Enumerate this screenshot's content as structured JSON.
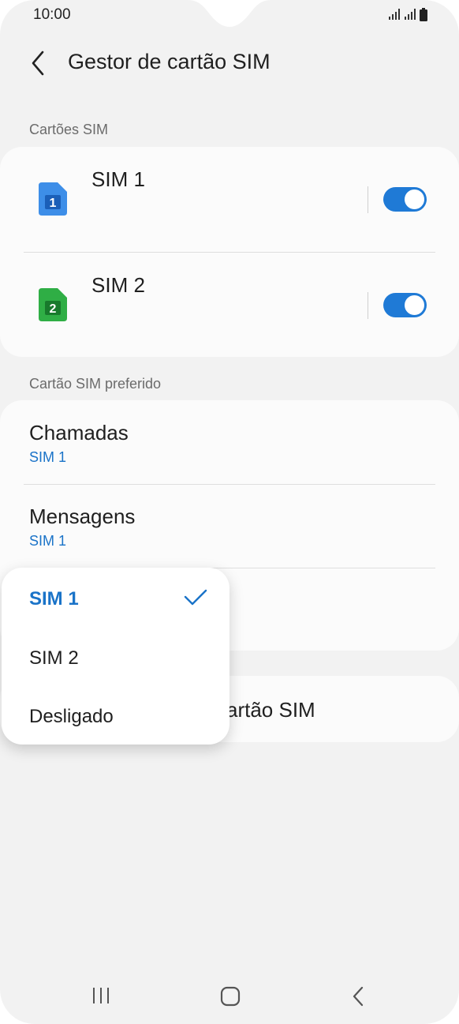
{
  "status_bar": {
    "time": "10:00",
    "icons": [
      "signal-icon",
      "signal-icon",
      "battery-icon"
    ]
  },
  "header": {
    "title": "Gestor de cartão SIM",
    "back_icon": "chevron-left-icon"
  },
  "sim_cards": {
    "section_label": "Cartões SIM",
    "items": [
      {
        "name": "SIM 1",
        "badge": "1",
        "icon_color": "#3d8ee8",
        "enabled": true
      },
      {
        "name": "SIM 2",
        "badge": "2",
        "icon_color": "#2fae45",
        "enabled": true
      }
    ]
  },
  "preferred": {
    "section_label": "Cartão SIM preferido",
    "items": [
      {
        "label": "Chamadas",
        "value": "SIM 1"
      },
      {
        "label": "Mensagens",
        "value": "SIM 1"
      }
    ]
  },
  "more_card": {
    "partial_label": "artão SIM"
  },
  "dropdown": {
    "options": [
      "SIM 1",
      "SIM 2",
      "Desligado"
    ],
    "selected": "SIM 1"
  },
  "nav_bar": {
    "icons": [
      "recent-apps-icon",
      "home-icon",
      "back-icon"
    ]
  },
  "colors": {
    "accent": "#1a73c8",
    "toggle_on": "#1f7ad6",
    "background": "#f2f2f2",
    "card": "#fbfbfb"
  }
}
